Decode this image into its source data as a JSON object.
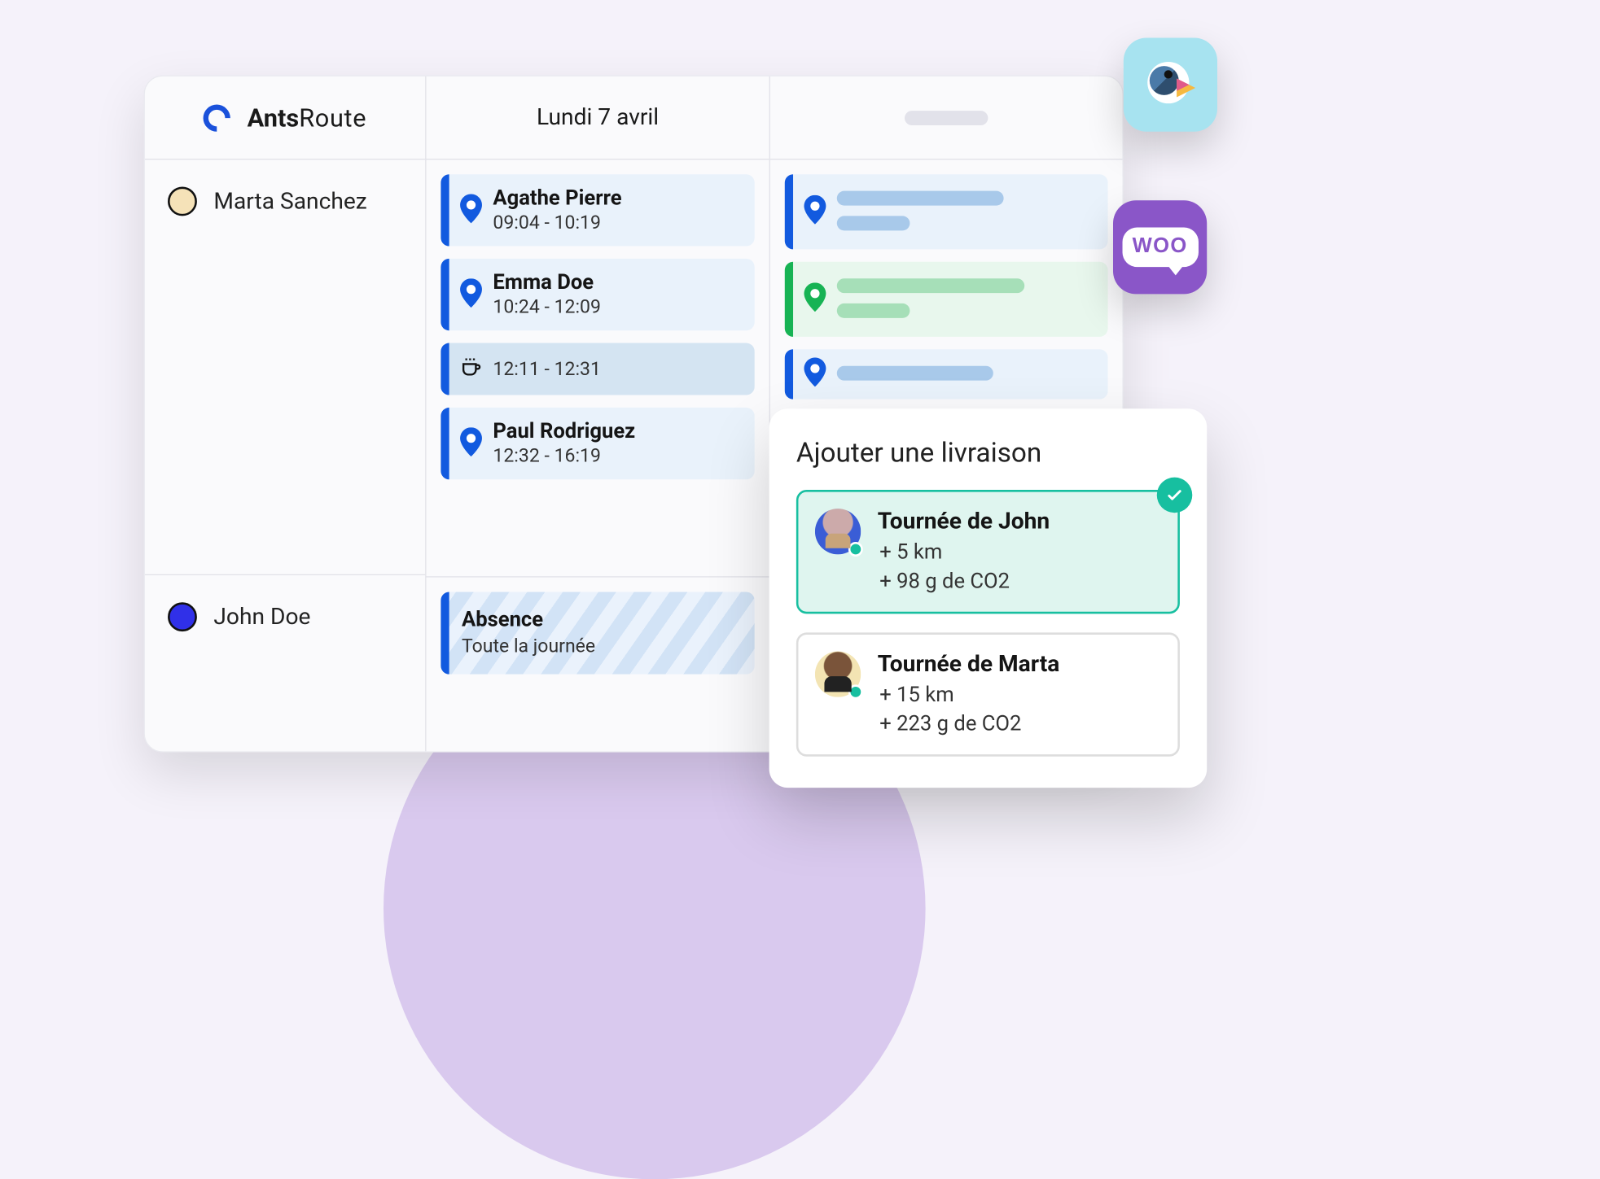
{
  "brand": {
    "name_bold": "Ants",
    "name_thin": "Route"
  },
  "date_header": "Lundi 7 avril",
  "drivers": [
    {
      "name": "Marta Sanchez",
      "color": "cream"
    },
    {
      "name": "John Doe",
      "color": "blue"
    }
  ],
  "marta_stops": [
    {
      "name": "Agathe Pierre",
      "time": "09:04 - 10:19",
      "icon": "pin"
    },
    {
      "name": "Emma Doe",
      "time": "10:24 - 12:09",
      "icon": "pin"
    },
    {
      "name": "",
      "time": "12:11 - 12:31",
      "icon": "cup"
    },
    {
      "name": "Paul Rodriguez",
      "time": "12:32 - 16:19",
      "icon": "pin"
    }
  ],
  "john_absence": {
    "title": "Absence",
    "subtitle": "Toute la journée"
  },
  "popup": {
    "title": "Ajouter une livraison",
    "options": [
      {
        "label": "Tournée de John",
        "distance": "+ 5 km",
        "co2": "+ 98 g de CO2",
        "selected": true,
        "avatar": "john"
      },
      {
        "label": "Tournée de Marta",
        "distance": "+ 15 km",
        "co2": "+ 223 g de CO2",
        "selected": false,
        "avatar": "marta"
      }
    ]
  },
  "integrations": {
    "prestashop_icon": "prestashop-icon",
    "woocommerce_label": "WOO"
  }
}
